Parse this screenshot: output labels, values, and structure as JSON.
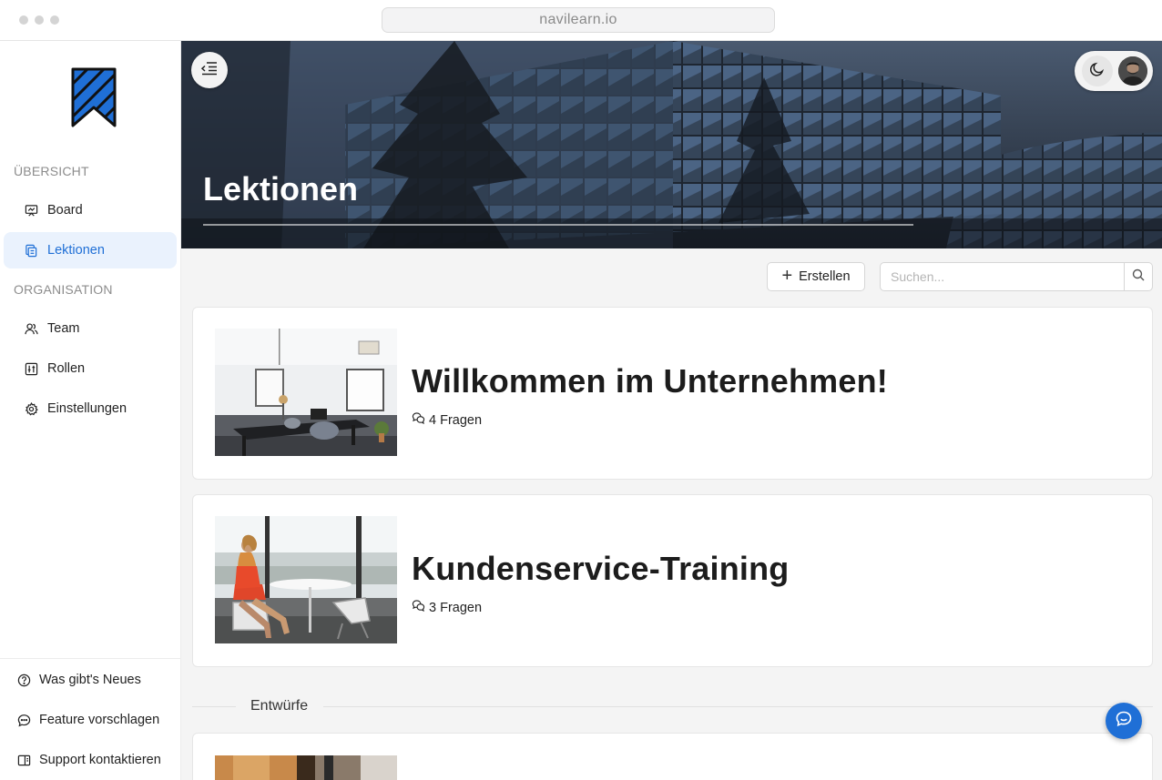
{
  "browser": {
    "url": "navilearn.io"
  },
  "sidebar": {
    "section_overview": "ÜBERSICHT",
    "section_org": "ORGANISATION",
    "items": [
      {
        "label": "Board",
        "icon": "presentation-icon",
        "active": false
      },
      {
        "label": "Lektionen",
        "icon": "copy-icon",
        "active": true
      },
      {
        "label": "Team",
        "icon": "users-icon",
        "active": false
      },
      {
        "label": "Rollen",
        "icon": "sliders-icon",
        "active": false
      },
      {
        "label": "Einstellungen",
        "icon": "gear-icon",
        "active": false
      }
    ],
    "footer": [
      {
        "label": "Was gibt's Neues",
        "icon": "help-circle-icon"
      },
      {
        "label": "Feature vorschlagen",
        "icon": "message-dots-icon"
      },
      {
        "label": "Support kontaktieren",
        "icon": "support-icon"
      }
    ]
  },
  "hero": {
    "title": "Lektionen"
  },
  "toolbar": {
    "create_label": "Erstellen",
    "search_placeholder": "Suchen..."
  },
  "lessons": [
    {
      "title": "Willkommen im Unternehmen!",
      "questions": "4 Fragen"
    },
    {
      "title": "Kundenservice-Training",
      "questions": "3 Fragen"
    }
  ],
  "drafts": {
    "label": "Entwürfe"
  },
  "colors": {
    "accent": "#1f6fd6",
    "active_bg": "#eaf2fd"
  }
}
